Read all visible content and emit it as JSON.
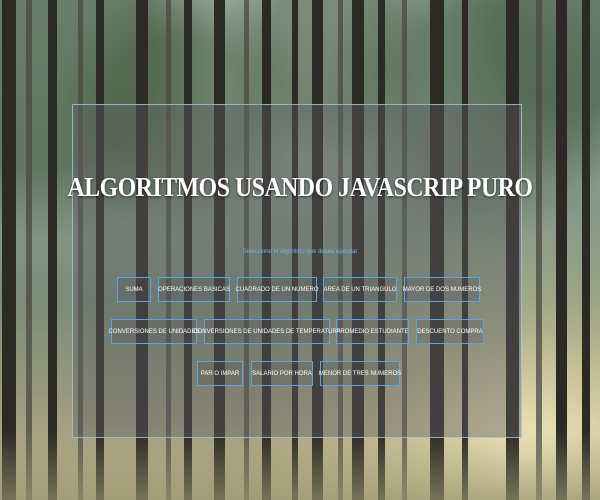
{
  "header": {
    "title": "ALGORITMOS USANDO JAVASCRIP PURO",
    "subtitle": "Seleccione el algoritmo que desee ejecutar"
  },
  "buttons": [
    {
      "label": "SUMA"
    },
    {
      "label": "OPERACIONES BASICAS"
    },
    {
      "label": "CUADRADO DE UN NUMERO"
    },
    {
      "label": "AREA DE UN TRIANGULO"
    },
    {
      "label": "MAYOR DE DOS NUMEROS"
    },
    {
      "label": "CONVERSIONES DE UNIDADES"
    },
    {
      "label": "CONVERSIONES DE UNIDADES DE TEMPERATURA"
    },
    {
      "label": "PROMEDIO ESTUDIANTE"
    },
    {
      "label": "DESCUENTO COMPRA"
    },
    {
      "label": "PAR O IMPAR"
    },
    {
      "label": "SALARIO POR HORA"
    },
    {
      "label": "MENOR DE TRES NUMEROS"
    }
  ],
  "colors": {
    "accent": "#5aa6e0",
    "title": "#ffffff",
    "subtitle": "#6fb6ee"
  }
}
